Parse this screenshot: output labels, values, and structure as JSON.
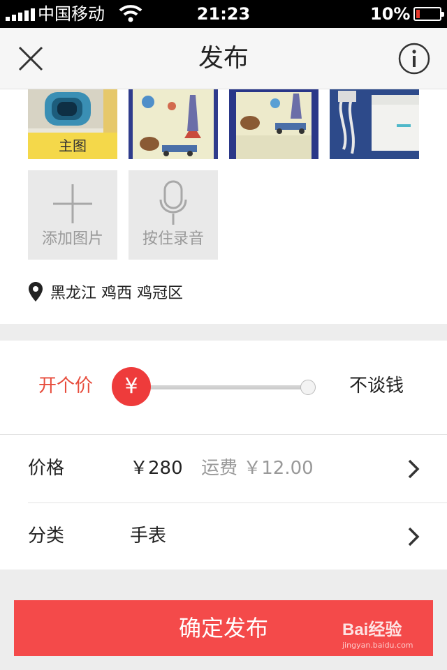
{
  "status_bar": {
    "carrier": "中国移动",
    "time": "21:23",
    "battery_percent": "10%"
  },
  "navbar": {
    "title": "发布",
    "close_icon": "close-icon",
    "info_icon": "info-icon"
  },
  "photos": {
    "main_tag": "主图",
    "add_photo_label": "添加图片",
    "record_label": "按住录音"
  },
  "location": {
    "text": "黑龙江 鸡西 鸡冠区",
    "icon": "location-pin-icon"
  },
  "price_slider": {
    "left_label": "开个价",
    "right_label": "不谈钱",
    "knob_symbol": "¥",
    "level": 0
  },
  "form": {
    "price_key": "价格",
    "price_value": "￥280",
    "shipping": "运费 ￥12.00",
    "category_key": "分类",
    "category_value": "手表"
  },
  "submit_label": "确定发布",
  "watermark": {
    "logo": "Bai经验",
    "url": "jingyan.baidu.com"
  },
  "colors": {
    "accent": "#f44a4a",
    "main_tag": "#f4d84a"
  }
}
